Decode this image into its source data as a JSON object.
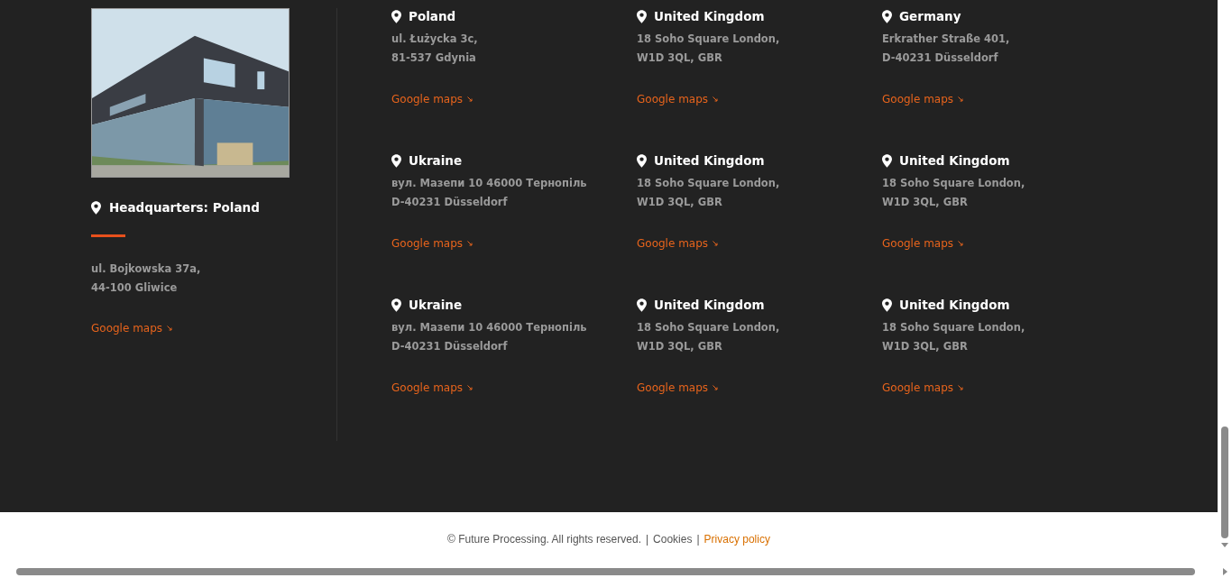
{
  "headquarters": {
    "title": "Headquarters: Poland",
    "address": [
      "ul. Bojkowska 37a,",
      "44-100 Gliwice"
    ],
    "link": "Google maps"
  },
  "offices": [
    {
      "country": "Poland",
      "address": [
        "ul. Łużycka 3c,",
        "81-537 Gdynia"
      ],
      "link": "Google maps"
    },
    {
      "country": "United Kingdom",
      "address": [
        "18 Soho Square London,",
        "W1D 3QL, GBR"
      ],
      "link": "Google maps"
    },
    {
      "country": "Germany",
      "address": [
        "Erkrather Straße 401,",
        "D-40231 Düsseldorf"
      ],
      "link": "Google maps"
    },
    {
      "country": "Ukraine",
      "address": [
        "вул. Мазепи 10 46000 Тернопіль",
        "D-40231 Düsseldorf"
      ],
      "link": "Google maps"
    },
    {
      "country": "United Kingdom",
      "address": [
        "18 Soho Square London,",
        "W1D 3QL, GBR"
      ],
      "link": "Google maps"
    },
    {
      "country": "United Kingdom",
      "address": [
        "18 Soho Square London,",
        "W1D 3QL, GBR"
      ],
      "link": "Google maps"
    },
    {
      "country": "Ukraine",
      "address": [
        "вул. Мазепи 10 46000 Тернопіль",
        "D-40231 Düsseldorf"
      ],
      "link": "Google maps"
    },
    {
      "country": "United Kingdom",
      "address": [
        "18 Soho Square London,",
        "W1D 3QL, GBR"
      ],
      "link": "Google maps"
    },
    {
      "country": "United Kingdom",
      "address": [
        "18 Soho Square London,",
        "W1D 3QL, GBR"
      ],
      "link": "Google maps"
    }
  ],
  "footer": [
    {
      "kind": "text",
      "text": "© Future Processing. All rights reserved."
    },
    {
      "kind": "sep",
      "text": "|"
    },
    {
      "kind": "link",
      "text": "Cookies"
    },
    {
      "kind": "sep",
      "text": "|"
    },
    {
      "kind": "accent-link",
      "text": "Privacy policy"
    }
  ]
}
